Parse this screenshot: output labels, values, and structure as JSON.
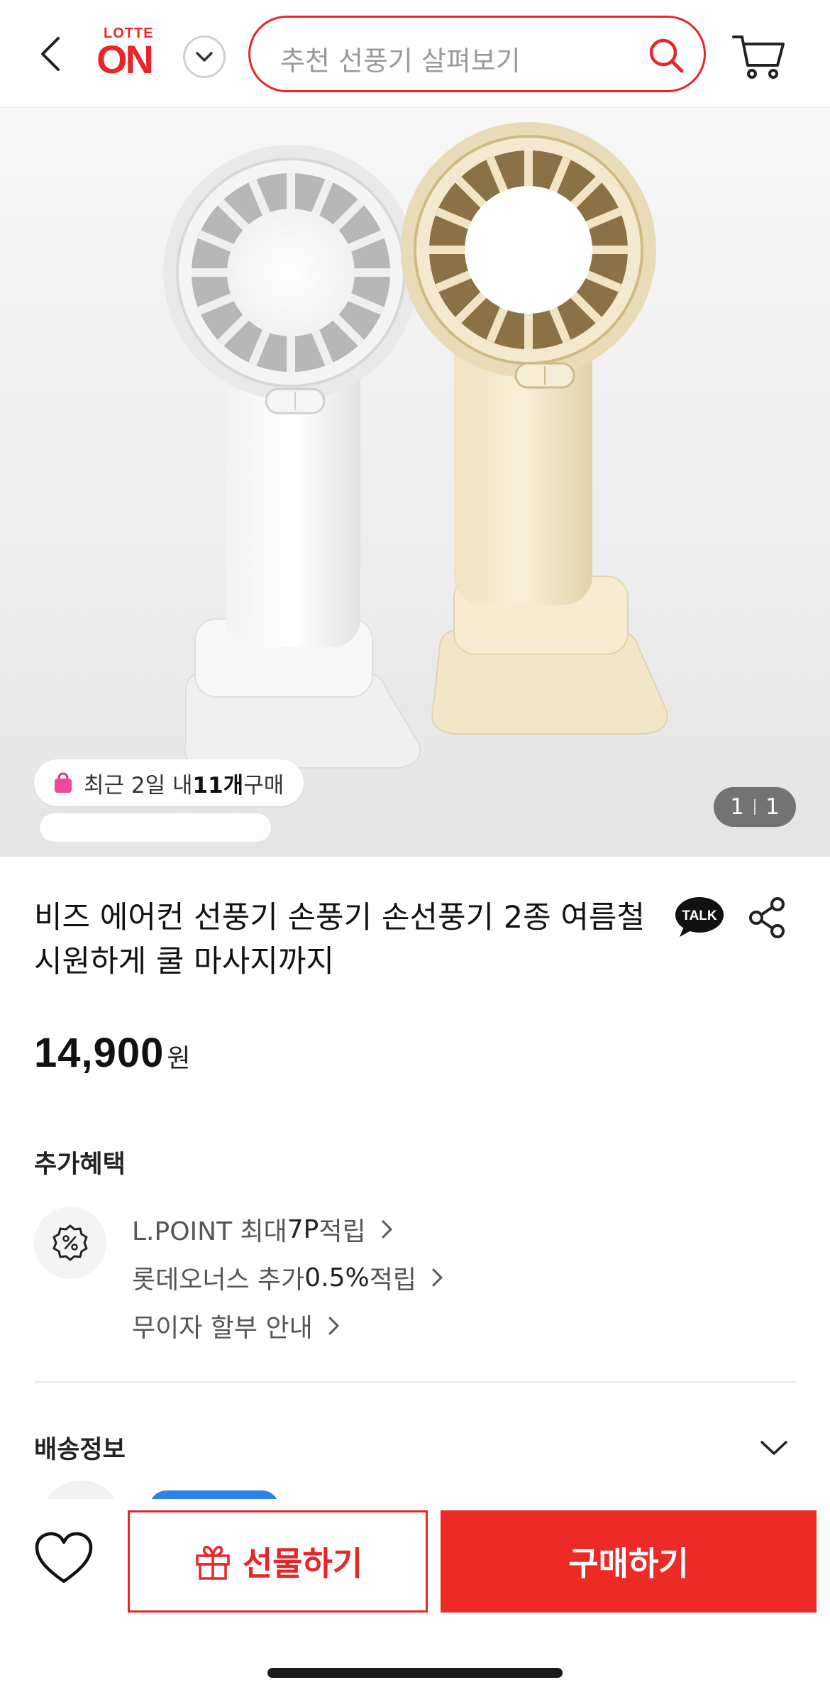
{
  "header": {
    "back_icon": "chevron-left-icon",
    "logo_top": "LOTTE",
    "logo_main": "ON",
    "logo_dropdown_icon": "chevron-down-icon",
    "search_placeholder": "추천 선풍기 살펴보기",
    "search_icon": "search-icon",
    "cart_icon": "cart-icon",
    "accent_color": "#e8262a"
  },
  "hero": {
    "image": "product-image-handheld-fans",
    "purchase_badge": {
      "prefix": "최근 2일 내 ",
      "count": "11개",
      "suffix": " 구매",
      "icon": "shopping-bag-icon"
    },
    "page_current": "1",
    "page_total": "1"
  },
  "product": {
    "title": "비즈 에어컨 선풍기 손풍기 손선풍기 2종 여름철 시원하게 쿨 마사지까지",
    "talk_icon": "kakao-talk-icon",
    "talk_label": "TALK",
    "share_icon": "share-icon",
    "price": "14,900",
    "price_unit": "원"
  },
  "benefits": {
    "heading": "추가혜택",
    "icon": "percent-icon",
    "items": [
      {
        "pre": "L.POINT 최대 ",
        "hl": "7P",
        "post": " 적립"
      },
      {
        "pre": "롯데오너스 추가 ",
        "hl": "0.5%",
        "post": " 적립"
      },
      {
        "pre": "무이자 할부 안내",
        "hl": "",
        "post": ""
      }
    ]
  },
  "shipping": {
    "heading": "배송정보",
    "toggle_icon": "chevron-down-icon"
  },
  "bottom_bar": {
    "wishlist_icon": "heart-icon",
    "gift_label": "선물하기",
    "gift_icon": "gift-icon",
    "buy_label": "구매하기",
    "buy_color": "#ed2a26"
  }
}
